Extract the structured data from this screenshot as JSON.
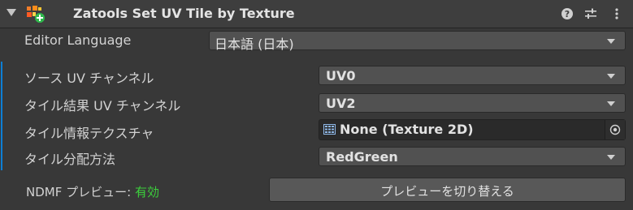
{
  "header": {
    "title": "Zatools Set UV Tile by Texture",
    "icons": [
      "foldout-arrow-icon",
      "component-icon",
      "help-icon",
      "preset-icon",
      "kebab-menu-icon"
    ]
  },
  "editor_language": {
    "label": "Editor Language",
    "value": "日本語 (日本)"
  },
  "fields": {
    "source_uv": {
      "label": "ソース UV チャンネル",
      "value": "UV0"
    },
    "tile_uv": {
      "label": "タイル結果 UV チャンネル",
      "value": "UV2"
    },
    "tile_texture": {
      "label": "タイル情報テクスチャ",
      "value": "None (Texture 2D)"
    },
    "tile_method": {
      "label": "タイル分配方法",
      "value": "RedGreen"
    }
  },
  "preview": {
    "label": "NDMF プレビュー: ",
    "status": "有効",
    "button_label": "プレビューを切り替える"
  },
  "colors": {
    "accent_blue": "#0d7fd5",
    "enabled_green": "#3ccf3c"
  }
}
